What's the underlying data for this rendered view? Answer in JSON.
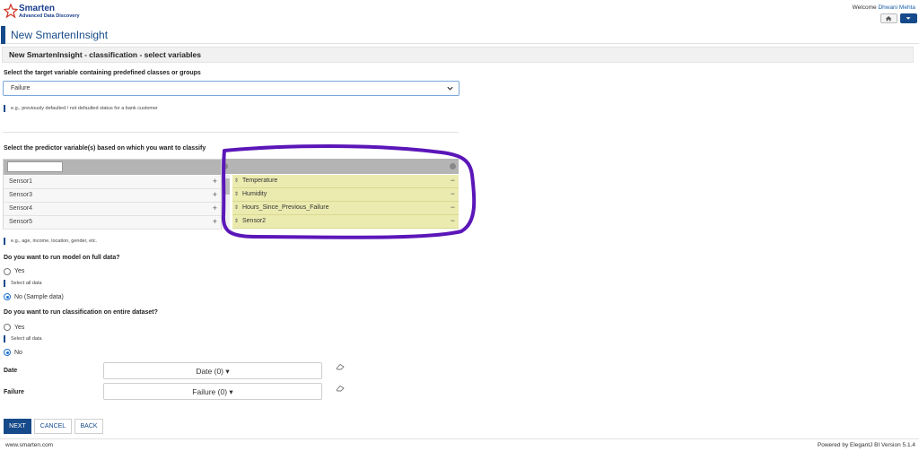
{
  "header": {
    "brand": "Smarten",
    "tagline": "Advanced Data Discovery",
    "welcome_prefix": "Welcome",
    "user_name": "Dhwani Mehta"
  },
  "page": {
    "title": "New SmartenInsight",
    "section_title": "New SmartenInsight - classification - select variables"
  },
  "target": {
    "label": "Select the target variable containing predefined classes or groups",
    "selected_value": "Failure",
    "hint": "e.g., previously defaulted / not defaulted status for a bank customer"
  },
  "predictors": {
    "label": "Select the predictor variable(s) based on which you want to classify",
    "available": [
      "Sensor1",
      "Sensor3",
      "Sensor4",
      "Sensor5"
    ],
    "selected": [
      "Temperature",
      "Humidity",
      "Hours_Since_Previous_Failure",
      "Sensor2"
    ],
    "hint": "e.g., age, income, location, gender, etc.",
    "plus_symbol": "+",
    "minus_symbol": "−",
    "grip_symbol": "⇕"
  },
  "full_data": {
    "question": "Do you want to run model on full data?",
    "option_yes": "Yes",
    "yes_hint": "Select all data",
    "option_no": "No (Sample data)",
    "selected": "no"
  },
  "entire_dataset": {
    "question": "Do you want to run classification on entire dataset?",
    "option_yes": "Yes",
    "yes_hint": "Select all data",
    "option_no": "No",
    "selected": "no"
  },
  "filters": [
    {
      "label": "Date",
      "dropdown": "Date (0)"
    },
    {
      "label": "Failure",
      "dropdown": "Failure (0)"
    }
  ],
  "dropdown_caret": "▾",
  "actions": {
    "next": "NEXT",
    "cancel": "CANCEL",
    "back": "BACK"
  },
  "footer": {
    "left": "www.smarten.com",
    "right": "Powered by ElegantJ BI Version 5.1.4"
  },
  "colors": {
    "primary": "#164a8a",
    "selected_row": "#ebebb0",
    "annotation": "#5b16b8"
  }
}
